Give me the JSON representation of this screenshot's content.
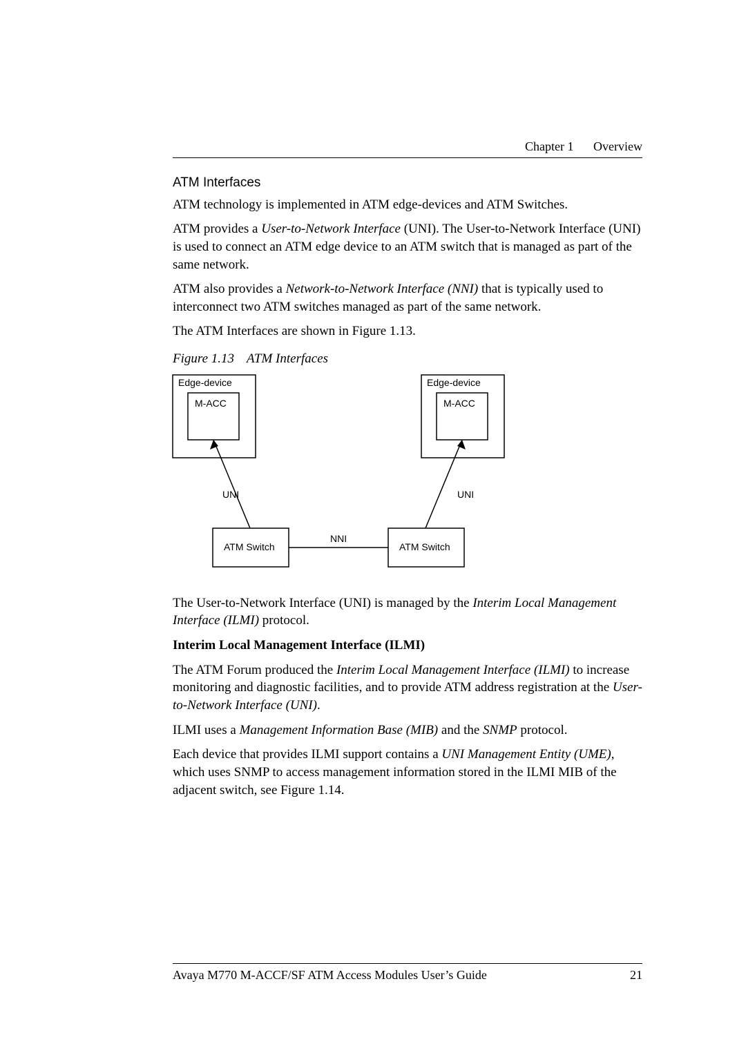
{
  "header": {
    "chapter": "Chapter 1",
    "title": "Overview"
  },
  "section": {
    "heading": "ATM Interfaces",
    "p1": "ATM technology is implemented in ATM edge-devices and ATM Switches.",
    "p2a": "ATM provides a ",
    "p2_em": "User-to-Network Interface",
    "p2b": " (UNI). The User-to-Network Interface (UNI) is used to connect an ATM edge device to an ATM switch that is managed as part of the same network.",
    "p3a": "ATM also provides a ",
    "p3_em": "Network-to-Network Interface (NNI)",
    "p3b": " that is typically used to interconnect two ATM switches managed as part of the same network.",
    "p4": "The ATM Interfaces are shown in Figure 1.13."
  },
  "figure": {
    "caption_label": "Figure 1.13",
    "caption_title": "ATM Interfaces",
    "edge_device": "Edge-device",
    "macc": "M-ACC",
    "uni": "UNI",
    "nni": "NNI",
    "atm_switch": "ATM Switch"
  },
  "after_fig": {
    "p1a": "The User-to-Network Interface (UNI) is managed by the ",
    "p1_em": "Interim Local Management Interface (ILMI)",
    "p1b": " protocol.",
    "bold": "Interim Local Management Interface (ILMI)",
    "p2a": "The ATM Forum produced the ",
    "p2_em": "Interim Local Management Interface (ILMI)",
    "p2b": " to increase monitoring and diagnostic facilities, and to provide ATM address registration at the ",
    "p2_em2": "User-to-Network Interface (UNI)",
    "p2c": ".",
    "p3a": "ILMI uses a ",
    "p3_em": "Management Information Base (MIB)",
    "p3b": " and the ",
    "p3_em2": "SNMP",
    "p3c": " protocol.",
    "p4a": "Each device that provides ILMI support contains a ",
    "p4_em": "UNI Management Entity (UME)",
    "p4b": ", which uses SNMP to access management information stored in the ILMI MIB of the adjacent switch, see Figure 1.14."
  },
  "footer": {
    "text": "Avaya M770 M-ACCF/SF ATM Access Modules User’s Guide",
    "page": "21"
  }
}
